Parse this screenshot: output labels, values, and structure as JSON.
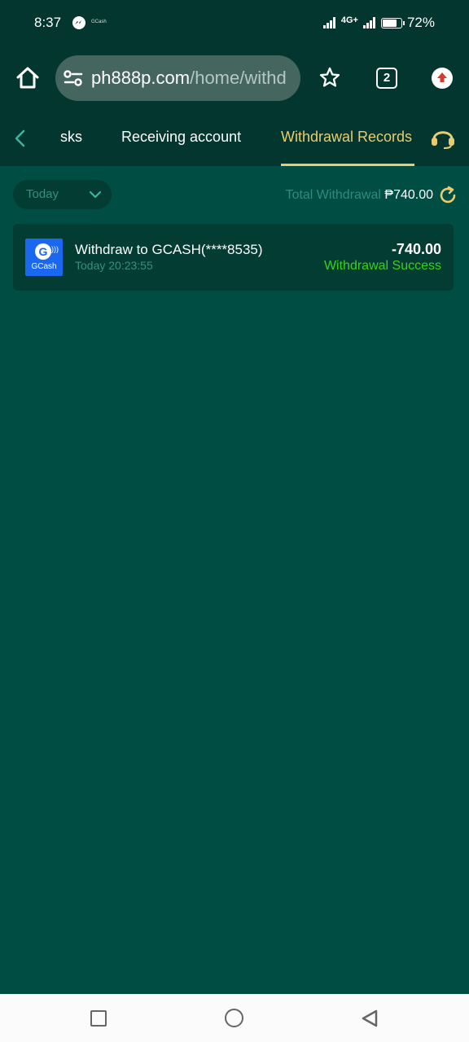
{
  "status_bar": {
    "time": "8:37",
    "notification_app": "GCash",
    "network": "4G+",
    "battery": "72%",
    "battery_level": 0.72
  },
  "browser": {
    "url_host": "ph888p.com",
    "url_path": "/home/withd",
    "tab_count": "2",
    "icons": [
      "home-icon",
      "site-settings-icon",
      "star-icon",
      "tabs-icon",
      "menu-icon"
    ]
  },
  "page_nav": {
    "tabs": [
      {
        "label": "sks"
      },
      {
        "label": "Receiving account"
      },
      {
        "label": "Withdrawal Records",
        "active": true
      }
    ],
    "accent_color": "#e8cc72"
  },
  "filter": {
    "date_selected": "Today",
    "total_label": "Total Withdrawal",
    "total_value": "₱740.00"
  },
  "records": [
    {
      "logo_text": "GCash",
      "logo_letter": "G",
      "title": "Withdraw to GCASH(****8535)",
      "time": "Today 20:23:55",
      "amount": "-740.00",
      "status": "Withdrawal Success",
      "status_color": "#39d11f"
    }
  ]
}
